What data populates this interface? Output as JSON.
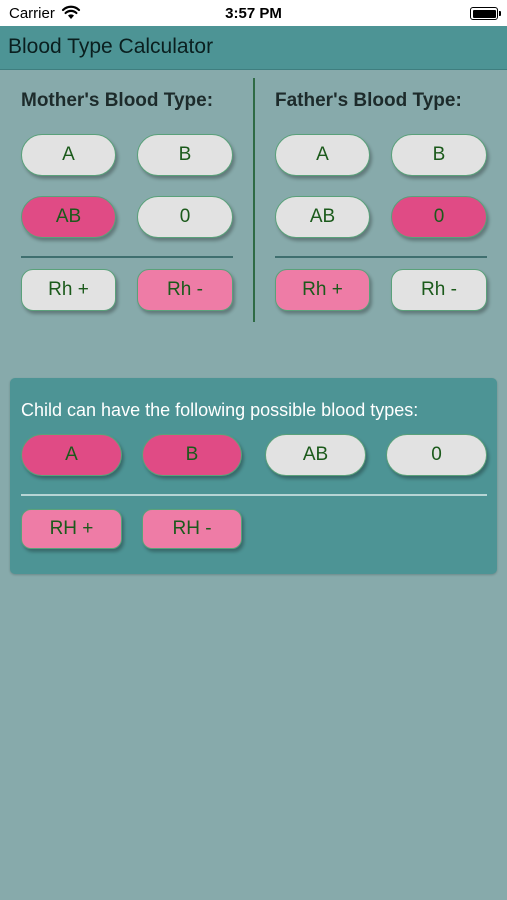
{
  "status": {
    "carrier": "Carrier",
    "time": "3:57 PM"
  },
  "app": {
    "title": "Blood Type Calculator"
  },
  "mother": {
    "heading": "Mother's Blood Type:",
    "types": [
      {
        "label": "A",
        "selected": false
      },
      {
        "label": "B",
        "selected": false
      },
      {
        "label": "AB",
        "selected": true
      },
      {
        "label": "0",
        "selected": false
      }
    ],
    "rh": [
      {
        "label": "Rh  +",
        "selected": false
      },
      {
        "label": "Rh -",
        "selected": true
      }
    ]
  },
  "father": {
    "heading": "Father's Blood Type:",
    "types": [
      {
        "label": "A",
        "selected": false
      },
      {
        "label": "B",
        "selected": false
      },
      {
        "label": "AB",
        "selected": false
      },
      {
        "label": "0",
        "selected": true
      }
    ],
    "rh": [
      {
        "label": "Rh +",
        "selected": true
      },
      {
        "label": "Rh -",
        "selected": false
      }
    ]
  },
  "child": {
    "heading": "Child can have the following possible blood types:",
    "types": [
      {
        "label": "A",
        "possible": true
      },
      {
        "label": "B",
        "possible": true
      },
      {
        "label": "AB",
        "possible": false
      },
      {
        "label": "0",
        "possible": false
      }
    ],
    "rh": [
      {
        "label": "RH +"
      },
      {
        "label": "RH -"
      }
    ]
  },
  "colors": {
    "background": "#87aaab",
    "nav": "#4d9495",
    "selected": "#e04b85",
    "rh_selected": "#ee7ca6",
    "unselected": "#e2e2e2",
    "text": "#1b5a1b"
  }
}
